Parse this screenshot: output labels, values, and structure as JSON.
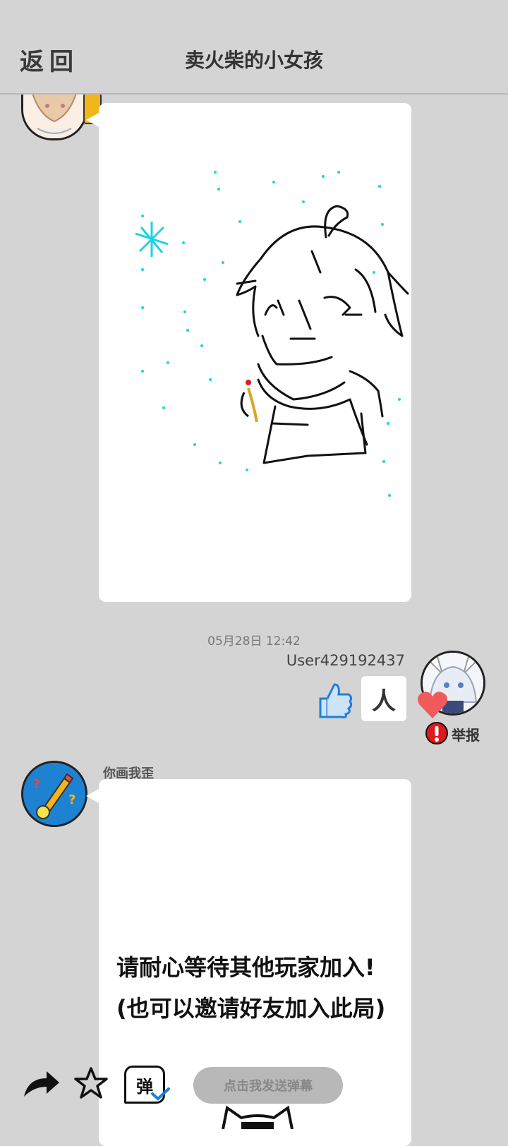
{
  "header": {
    "back_label": "返回",
    "title": "卖火柴的小女孩"
  },
  "feed": {
    "timestamp": "05月28日  12:42",
    "guess": {
      "username": "User429192437",
      "answer": "人",
      "report_label": "举报"
    },
    "system_message": {
      "sender": "你画我歪",
      "line1": "请耐心等待其他玩家加入!",
      "line2": "(也可以邀请好友加入此局)"
    }
  },
  "footer": {
    "danmaku_placeholder": "点击我发送弹幕",
    "danmaku_icon_label": "弹"
  },
  "colors": {
    "background": "#d4d4d4",
    "bubble": "#ffffff",
    "like_blue": "#1e7fd8",
    "heart_red": "#f05a5a",
    "report_red": "#e01a1a",
    "snow_cyan": "#19d4e6"
  },
  "icons": [
    "share-icon",
    "star-icon",
    "danmaku-icon",
    "thumbs-up-icon",
    "heart-icon",
    "report-icon"
  ]
}
